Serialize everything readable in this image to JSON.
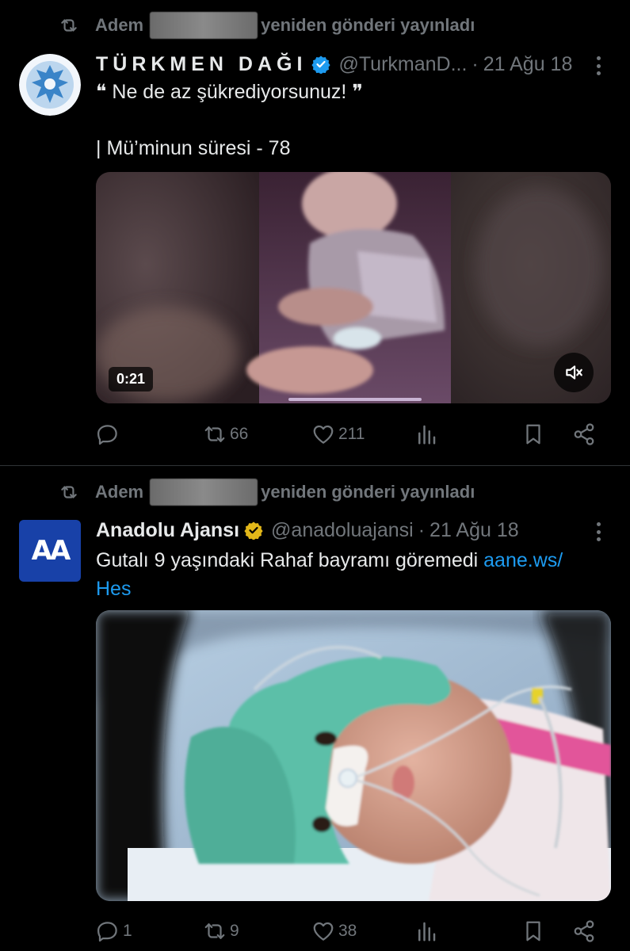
{
  "posts": [
    {
      "repost_prefix": "Adem",
      "repost_suffix": "yeniden gönderi yayınladı",
      "author_name": "TÜRKMEN DAĞI",
      "author_handle": "@TurkmanD...",
      "date": "21 Ağu 18",
      "text_line1": "❝ Ne de az şükrediyorsunuz! ❞",
      "text_line2": "| Mü’minun süresi - 78",
      "video_duration": "0:21",
      "stats": {
        "replies": "",
        "reposts": "66",
        "likes": "211"
      }
    },
    {
      "repost_prefix": "Adem",
      "repost_suffix": "yeniden gönderi yayınladı",
      "author_name": "Anadolu Ajansı",
      "author_handle": "@anadoluajansi",
      "date": "21 Ağu 18",
      "avatar_text": "AA",
      "text_main": "Gutalı 9 yaşındaki Rahaf bayramı göremedi ",
      "link_part1": "aane.ws/",
      "link_part2": "Hes",
      "stats": {
        "replies": "1",
        "reposts": "9",
        "likes": "38"
      }
    }
  ],
  "colors": {
    "background": "#000000",
    "muted": "#71767b",
    "link": "#1d9bf0",
    "verified_blue": "#1d9bf0",
    "verified_gold": "#e2b719"
  },
  "icons": [
    "repost-icon",
    "verified-badge-icon",
    "more-icon",
    "reply-icon",
    "like-icon",
    "views-icon",
    "bookmark-icon",
    "share-icon",
    "mute-icon"
  ]
}
